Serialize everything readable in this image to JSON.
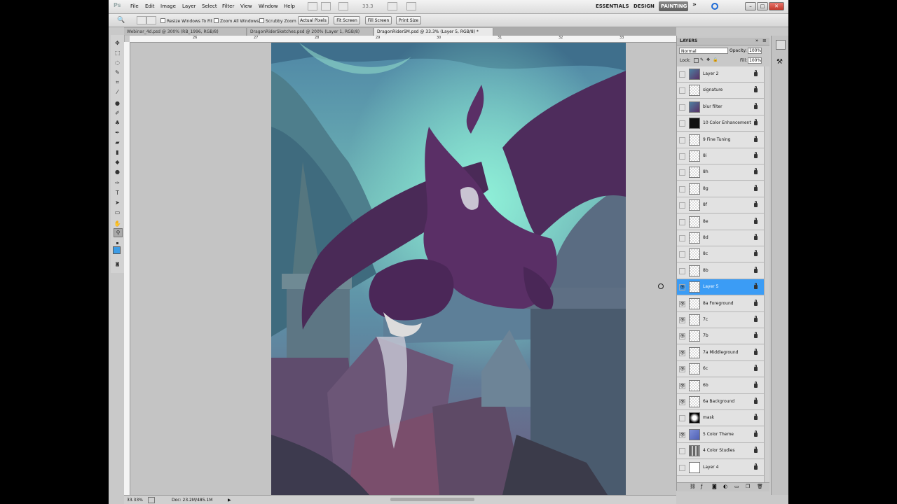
{
  "menubar": {
    "logo": "Ps",
    "items": [
      "File",
      "Edit",
      "Image",
      "Layer",
      "Select",
      "Filter",
      "View",
      "Window",
      "Help"
    ],
    "zoom_value": "33.3",
    "workspaces": [
      "ESSENTIALS",
      "DESIGN",
      "PAINTING"
    ],
    "active_workspace": "PAINTING",
    "more": "»",
    "window_controls": [
      "–",
      "□",
      "✕"
    ]
  },
  "options": {
    "checkboxes": [
      "Resize Windows To Fit",
      "Zoom All Windows",
      "Scrubby Zoom"
    ],
    "buttons": [
      "Actual Pixels",
      "Fit Screen",
      "Fill Screen",
      "Print Size"
    ]
  },
  "tabs": [
    "Webinar_4d.psd @ 300% (RB_1996, RGB/8)",
    "DragonRiderSketches.psd @ 200% (Layer 1, RGB/8)",
    "DragonRiderSM.psd @ 33.3% (Layer 5, RGB/8) *"
  ],
  "ruler": {
    "h_labels": [
      "26",
      "27",
      "28",
      "29",
      "30",
      "31",
      "32",
      "33"
    ]
  },
  "status": {
    "zoom": "33.33%",
    "doc": "Doc: 23.2M/485.1M"
  },
  "layers_panel": {
    "title": "LAYERS",
    "blend_mode": "Normal",
    "opacity_label": "Opacity:",
    "opacity_value": "100%",
    "lock_label": "Lock:",
    "fill_label": "Fill:",
    "fill_value": "100%",
    "layers": [
      {
        "name": "Layer 2",
        "visible": false,
        "thumb": "art"
      },
      {
        "name": "signature",
        "visible": false,
        "thumb": "checker"
      },
      {
        "name": "blur filter",
        "visible": false,
        "thumb": "art"
      },
      {
        "name": "10 Color Enhancement",
        "visible": false,
        "thumb": "dark"
      },
      {
        "name": "9 Fine Tuning",
        "visible": false,
        "thumb": "checker"
      },
      {
        "name": "8i",
        "visible": false,
        "thumb": "checker"
      },
      {
        "name": "8h",
        "visible": false,
        "thumb": "checker"
      },
      {
        "name": "8g",
        "visible": false,
        "thumb": "checker"
      },
      {
        "name": "8f",
        "visible": false,
        "thumb": "checker"
      },
      {
        "name": "8e",
        "visible": false,
        "thumb": "checker"
      },
      {
        "name": "8d",
        "visible": false,
        "thumb": "checker"
      },
      {
        "name": "8c",
        "visible": false,
        "thumb": "checker"
      },
      {
        "name": "8b",
        "visible": false,
        "thumb": "checker"
      },
      {
        "name": "Layer 5",
        "visible": true,
        "thumb": "checker",
        "selected": true
      },
      {
        "name": "8a Foreground",
        "visible": true,
        "thumb": "checker"
      },
      {
        "name": "7c",
        "visible": true,
        "thumb": "checker"
      },
      {
        "name": "7b",
        "visible": true,
        "thumb": "checker"
      },
      {
        "name": "7a Middleground",
        "visible": true,
        "thumb": "checker"
      },
      {
        "name": "6c",
        "visible": true,
        "thumb": "checker"
      },
      {
        "name": "6b",
        "visible": true,
        "thumb": "checker"
      },
      {
        "name": "6a Background",
        "visible": true,
        "thumb": "checker"
      },
      {
        "name": "mask",
        "visible": false,
        "thumb": "mask"
      },
      {
        "name": "5 Color Theme",
        "visible": true,
        "thumb": "blue"
      },
      {
        "name": "4 Color Studies",
        "visible": false,
        "thumb": "grid"
      },
      {
        "name": "Layer 4",
        "visible": false,
        "thumb": "white"
      }
    ]
  },
  "colors": {
    "selection": "#3b9cf5",
    "ps_blue": "#1e6bd6"
  }
}
